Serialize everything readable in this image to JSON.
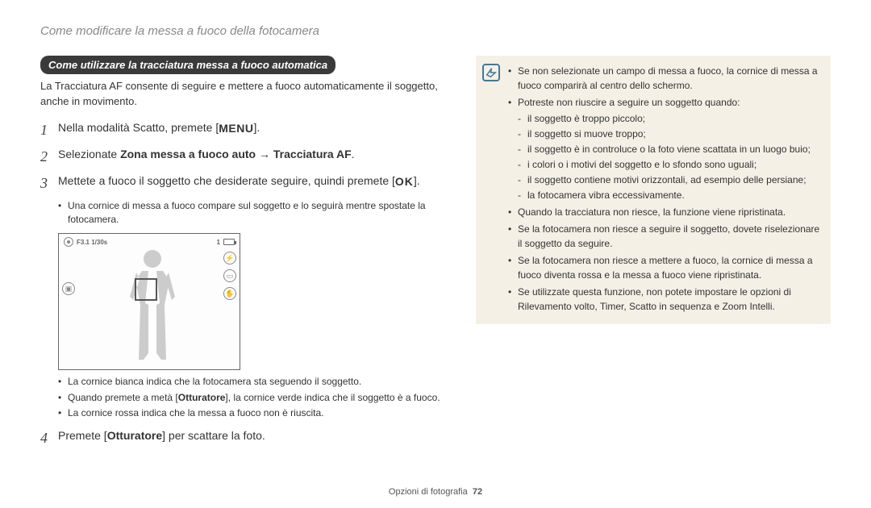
{
  "header": {
    "title": "Come modificare la messa a fuoco della fotocamera"
  },
  "pill": "Come utilizzare la tracciatura messa a fuoco automatica",
  "intro": "La Tracciatura AF consente di seguire e mettere a fuoco automaticamente il soggetto, anche in movimento.",
  "steps": {
    "s1": {
      "num": "1",
      "text_pre": "Nella modalità Scatto, premete [",
      "text_post": "]."
    },
    "s2": {
      "num": "2",
      "pre": "Selezionate ",
      "bold1": "Zona messa a fuoco auto",
      "arrow": " → ",
      "bold2": "Tracciatura AF",
      "post": "."
    },
    "s3": {
      "num": "3",
      "pre": "Mettete a fuoco il soggetto che desiderate seguire, quindi premete [",
      "post": "]."
    },
    "s4": {
      "num": "4",
      "pre": "Premete [",
      "bold": "Otturatore",
      "post": "] per scattare la foto."
    }
  },
  "sub3": {
    "a": "Una cornice di messa a fuoco compare sul soggetto e lo seguirà mentre spostate la fotocamera.",
    "b": "La cornice bianca indica che la fotocamera sta seguendo il soggetto.",
    "c_pre": "Quando premete a metà [",
    "c_bold": "Otturatore",
    "c_post": "], la cornice verde indica che il soggetto è a fuoco.",
    "d": "La cornice rossa indica che la messa a fuoco non è riuscita."
  },
  "camera": {
    "info": "F3.1  1/30s",
    "count": "1"
  },
  "notes": {
    "n1": "Se non selezionate un campo di messa a fuoco, la cornice di messa a fuoco comparirà al centro dello schermo.",
    "n2_head": "Potreste non riuscire a seguire un soggetto quando:",
    "n2_a": "il soggetto è troppo piccolo;",
    "n2_b": "il soggetto si muove troppo;",
    "n2_c": "il soggetto è in controluce o la foto viene scattata in un luogo buio;",
    "n2_d": "i colori o i motivi del soggetto e lo sfondo sono uguali;",
    "n2_e": "il soggetto contiene motivi orizzontali, ad esempio delle persiane;",
    "n2_f": "la fotocamera vibra eccessivamente.",
    "n3": "Quando la tracciatura non riesce, la funzione viene ripristinata.",
    "n4": "Se la fotocamera non riesce a seguire il soggetto, dovete riselezionare il soggetto da seguire.",
    "n5": "Se la fotocamera non riesce a mettere a fuoco, la cornice di messa a fuoco diventa rossa e la messa a fuoco viene ripristinata.",
    "n6": "Se utilizzate questa funzione, non potete impostare le opzioni di Rilevamento volto, Timer, Scatto in sequenza e Zoom Intelli."
  },
  "icons": {
    "menu": "MENU",
    "ok": "OK"
  },
  "footer": {
    "section": "Opzioni di fotografia",
    "page": "72"
  }
}
